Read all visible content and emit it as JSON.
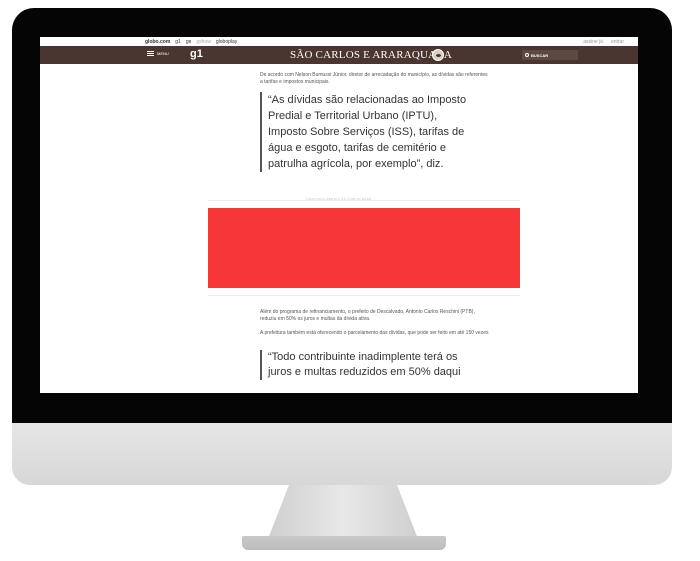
{
  "globo_bar": {
    "links": [
      "globo.com",
      "g1",
      "ge",
      "gshow",
      "globoplay"
    ],
    "right": [
      "assine já",
      "entrar"
    ]
  },
  "header": {
    "menu_label": "MENU",
    "logo": "g1",
    "region_title": "SÃO CARLOS E ARARAQUARA",
    "search_label": "BUSCAR"
  },
  "article": {
    "intro": "De acordo com Nelson Bumussi Júnior, diretor de arrecadação do município, as dívidas são referentes a tarifas e impostos municipais.",
    "quote1": "“As dívidas são relacionadas ao Imposto Predial e Territorial Urbano (IPTU), Imposto Sobre Serviços (ISS), tarifas de água e esgoto, tarifas de cemitério e patrulha agrícola, por exemplo”, diz.",
    "ad_label": "CONTINUA DEPOIS DA PUBLICIDADE",
    "para2": "Além do programa de refinanciamento, o prefeito de Descalvado, Antonio Carlos Reschini (PTB), reduziu em 50% os juros e multas da dívida ativa.",
    "para3": "A prefeitura também está oferecendo o parcelamento das dívidas, que pode ser feito em até 150 vezes",
    "quote2": "“Todo contribuinte inadimplente terá os juros e multas reduzidos em 50% daqui"
  },
  "colors": {
    "header_bg": "#4a3530",
    "ad_banner": "#f73737"
  }
}
